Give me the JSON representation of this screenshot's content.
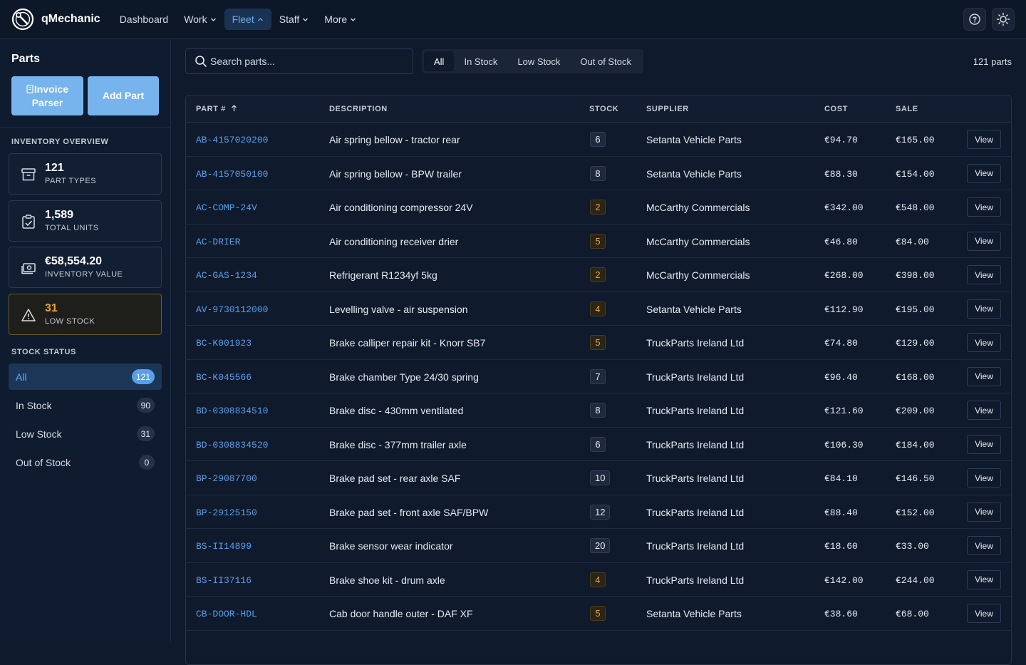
{
  "app": {
    "name": "qMechanic"
  },
  "nav": {
    "items": [
      {
        "label": "Dashboard",
        "dropdown": false,
        "active": false
      },
      {
        "label": "Work",
        "dropdown": true,
        "active": false
      },
      {
        "label": "Fleet",
        "dropdown": true,
        "active": true
      },
      {
        "label": "Staff",
        "dropdown": true,
        "active": false
      },
      {
        "label": "More",
        "dropdown": true,
        "active": false
      }
    ]
  },
  "sidebar": {
    "title": "Parts",
    "invoice_button": "Invoice Parser",
    "add_button": "Add Part",
    "overview_label": "INVENTORY OVERVIEW",
    "stats": [
      {
        "value": "121",
        "label": "PART TYPES",
        "icon": "archive-icon"
      },
      {
        "value": "1,589",
        "label": "TOTAL UNITS",
        "icon": "clipboard-check-icon"
      },
      {
        "value": "€58,554.20",
        "label": "INVENTORY VALUE",
        "icon": "cash-icon"
      },
      {
        "value": "31",
        "label": "LOW STOCK",
        "icon": "warning-icon"
      }
    ],
    "status_label": "STOCK STATUS",
    "status_items": [
      {
        "label": "All",
        "count": "121"
      },
      {
        "label": "In Stock",
        "count": "90"
      },
      {
        "label": "Low Stock",
        "count": "31"
      },
      {
        "label": "Out of Stock",
        "count": "0"
      }
    ]
  },
  "toolbar": {
    "search_placeholder": "Search parts...",
    "filters": [
      "All",
      "In Stock",
      "Low Stock",
      "Out of Stock"
    ],
    "part_count": "121 parts"
  },
  "table": {
    "headers": {
      "part": "PART #",
      "description": "DESCRIPTION",
      "stock": "STOCK",
      "supplier": "SUPPLIER",
      "cost": "COST",
      "sale": "SALE"
    },
    "view_label": "View",
    "rows": [
      {
        "part": "AB-4157020200",
        "description": "Air spring bellow - tractor rear",
        "stock": "6",
        "low": false,
        "supplier": "Setanta Vehicle Parts",
        "cost": "€94.70",
        "sale": "€165.00"
      },
      {
        "part": "AB-4157050100",
        "description": "Air spring bellow - BPW trailer",
        "stock": "8",
        "low": false,
        "supplier": "Setanta Vehicle Parts",
        "cost": "€88.30",
        "sale": "€154.00"
      },
      {
        "part": "AC-COMP-24V",
        "description": "Air conditioning compressor 24V",
        "stock": "2",
        "low": true,
        "supplier": "McCarthy Commercials",
        "cost": "€342.00",
        "sale": "€548.00"
      },
      {
        "part": "AC-DRIER",
        "description": "Air conditioning receiver drier",
        "stock": "5",
        "low": true,
        "supplier": "McCarthy Commercials",
        "cost": "€46.80",
        "sale": "€84.00"
      },
      {
        "part": "AC-GAS-1234",
        "description": "Refrigerant R1234yf 5kg",
        "stock": "2",
        "low": true,
        "supplier": "McCarthy Commercials",
        "cost": "€268.00",
        "sale": "€398.00"
      },
      {
        "part": "AV-9730112000",
        "description": "Levelling valve - air suspension",
        "stock": "4",
        "low": true,
        "supplier": "Setanta Vehicle Parts",
        "cost": "€112.90",
        "sale": "€195.00"
      },
      {
        "part": "BC-K001923",
        "description": "Brake calliper repair kit - Knorr SB7",
        "stock": "5",
        "low": true,
        "supplier": "TruckParts Ireland Ltd",
        "cost": "€74.80",
        "sale": "€129.00"
      },
      {
        "part": "BC-K045566",
        "description": "Brake chamber Type 24/30 spring",
        "stock": "7",
        "low": false,
        "supplier": "TruckParts Ireland Ltd",
        "cost": "€96.40",
        "sale": "€168.00"
      },
      {
        "part": "BD-0308834510",
        "description": "Brake disc - 430mm ventilated",
        "stock": "8",
        "low": false,
        "supplier": "TruckParts Ireland Ltd",
        "cost": "€121.60",
        "sale": "€209.00"
      },
      {
        "part": "BD-0308834520",
        "description": "Brake disc - 377mm trailer axle",
        "stock": "6",
        "low": false,
        "supplier": "TruckParts Ireland Ltd",
        "cost": "€106.30",
        "sale": "€184.00"
      },
      {
        "part": "BP-29087700",
        "description": "Brake pad set - rear axle SAF",
        "stock": "10",
        "low": false,
        "supplier": "TruckParts Ireland Ltd",
        "cost": "€84.10",
        "sale": "€146.50"
      },
      {
        "part": "BP-29125150",
        "description": "Brake pad set - front axle SAF/BPW",
        "stock": "12",
        "low": false,
        "supplier": "TruckParts Ireland Ltd",
        "cost": "€88.40",
        "sale": "€152.00"
      },
      {
        "part": "BS-II14899",
        "description": "Brake sensor wear indicator",
        "stock": "20",
        "low": false,
        "supplier": "TruckParts Ireland Ltd",
        "cost": "€18.60",
        "sale": "€33.00"
      },
      {
        "part": "BS-II37116",
        "description": "Brake shoe kit - drum axle",
        "stock": "4",
        "low": true,
        "supplier": "TruckParts Ireland Ltd",
        "cost": "€142.00",
        "sale": "€244.00"
      },
      {
        "part": "CB-DOOR-HDL",
        "description": "Cab door handle outer - DAF XF",
        "stock": "5",
        "low": true,
        "supplier": "Setanta Vehicle Parts",
        "cost": "€38.60",
        "sale": "€68.00"
      }
    ]
  }
}
